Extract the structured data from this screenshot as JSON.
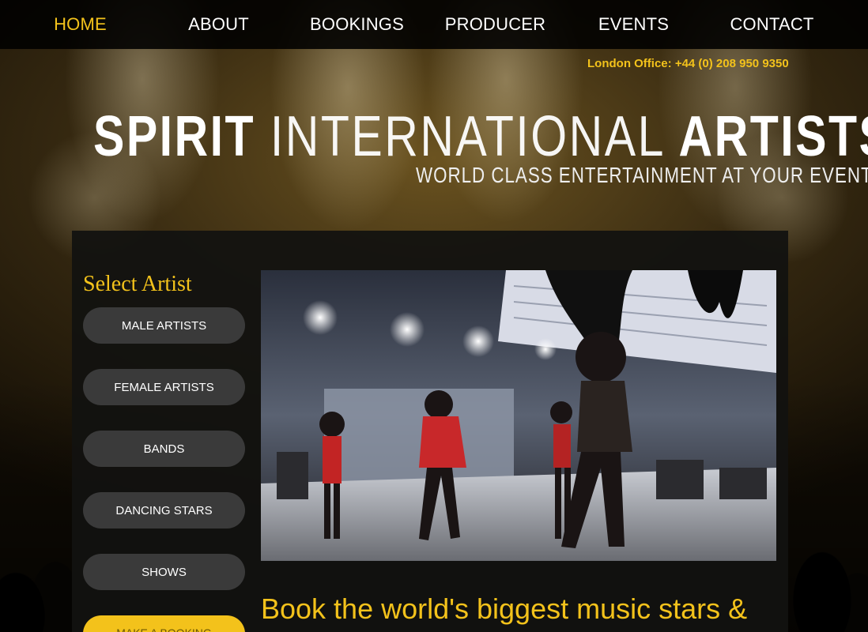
{
  "nav": {
    "items": [
      {
        "label": "HOME",
        "active": true
      },
      {
        "label": "ABOUT",
        "active": false
      },
      {
        "label": "BOOKINGS",
        "active": false
      },
      {
        "label": "PRODUCER",
        "active": false
      },
      {
        "label": "EVENTS",
        "active": false
      },
      {
        "label": "CONTACT",
        "active": false
      }
    ]
  },
  "header": {
    "phone": "London Office: +44 (0) 208 950 9350",
    "brand_part1": "SPIRIT ",
    "brand_part2": "INTERNATIONAL ",
    "brand_part3": "ARTISTS",
    "tagline": "WORLD CLASS ENTERTAINMENT AT YOUR EVENT"
  },
  "sidebar": {
    "title": "Select Artist",
    "buttons": [
      {
        "label": "MALE ARTISTS"
      },
      {
        "label": "FEMALE ARTISTS"
      },
      {
        "label": "BANDS"
      },
      {
        "label": "DANCING STARS"
      },
      {
        "label": "SHOWS"
      }
    ],
    "booking_button": "MAKE A BOOKING"
  },
  "main": {
    "headline": "Book the world's biggest music stars &"
  },
  "colors": {
    "accent": "#f3c21b",
    "nav_bg": "#000000",
    "panel_bg": "#121210",
    "button_bg": "#3a3a3a"
  }
}
